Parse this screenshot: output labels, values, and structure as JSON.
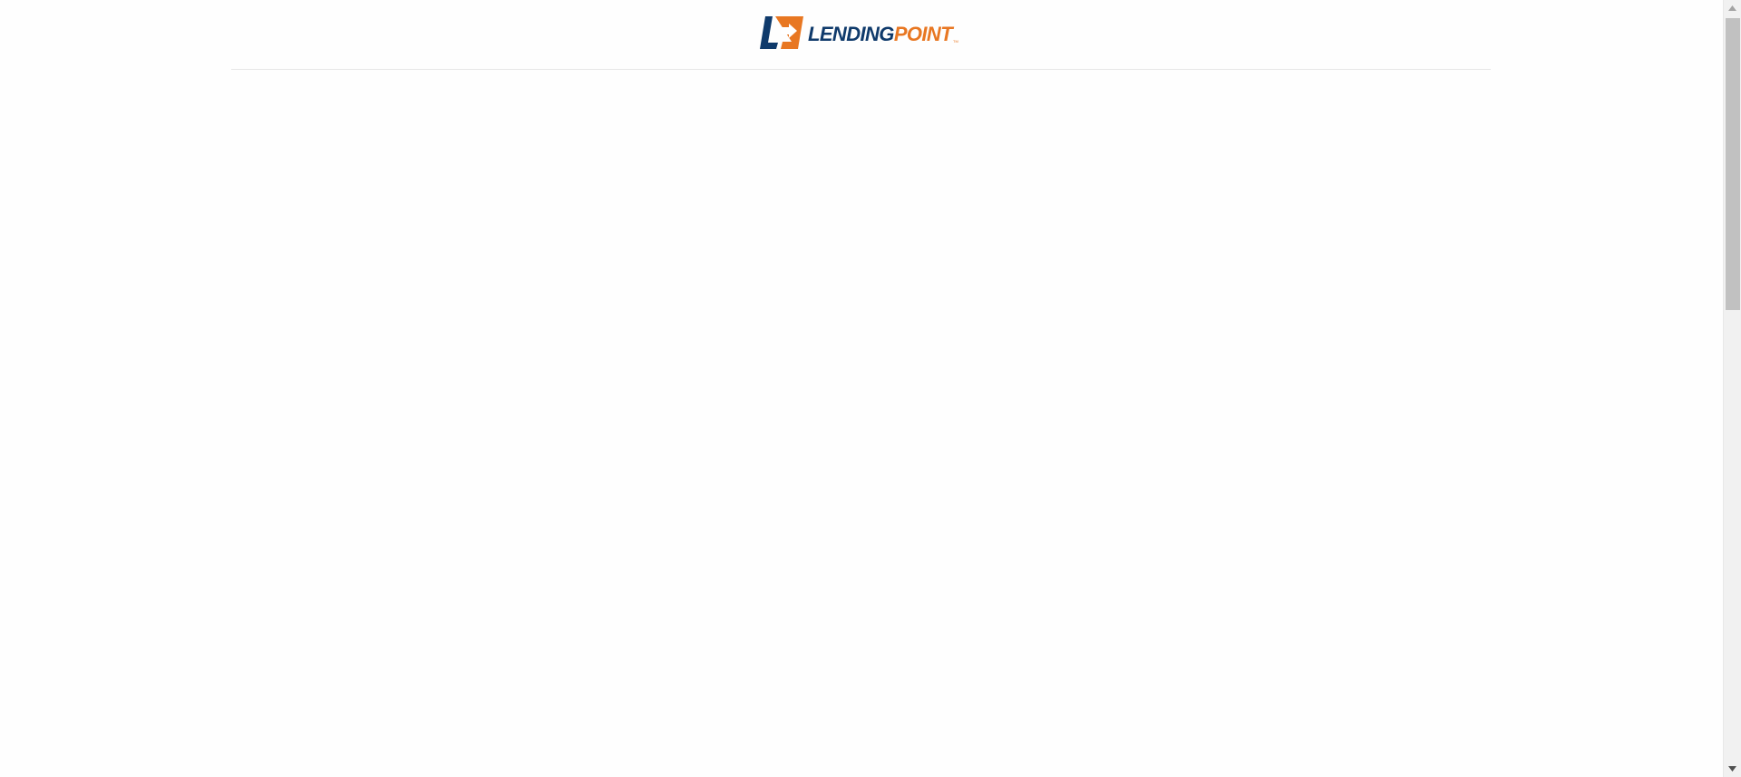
{
  "brand": {
    "name_part1": "LENDING",
    "name_part2": "POINT",
    "trademark": "TM",
    "colors": {
      "navy": "#0f3a6b",
      "orange": "#e87722"
    }
  },
  "scrollbar": {
    "up_icon": "triangle-up",
    "down_icon": "triangle-down",
    "position": 0.0
  }
}
